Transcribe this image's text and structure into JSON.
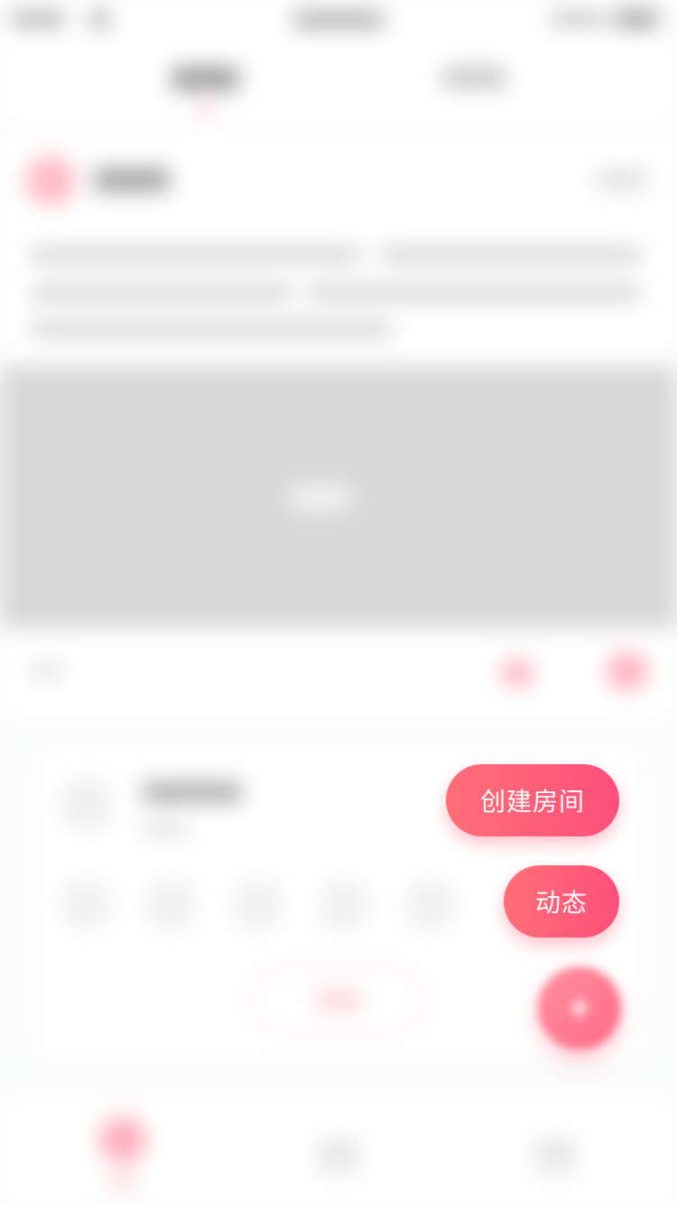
{
  "menu": {
    "create_room_label": "创建房间",
    "moment_label": "动态"
  },
  "colors": {
    "accent": "#ff5470",
    "fab_gradient_start": "#ff6f77",
    "fab_gradient_end": "#ff4f7b"
  },
  "icons": {
    "fab_main": "plus-icon"
  }
}
